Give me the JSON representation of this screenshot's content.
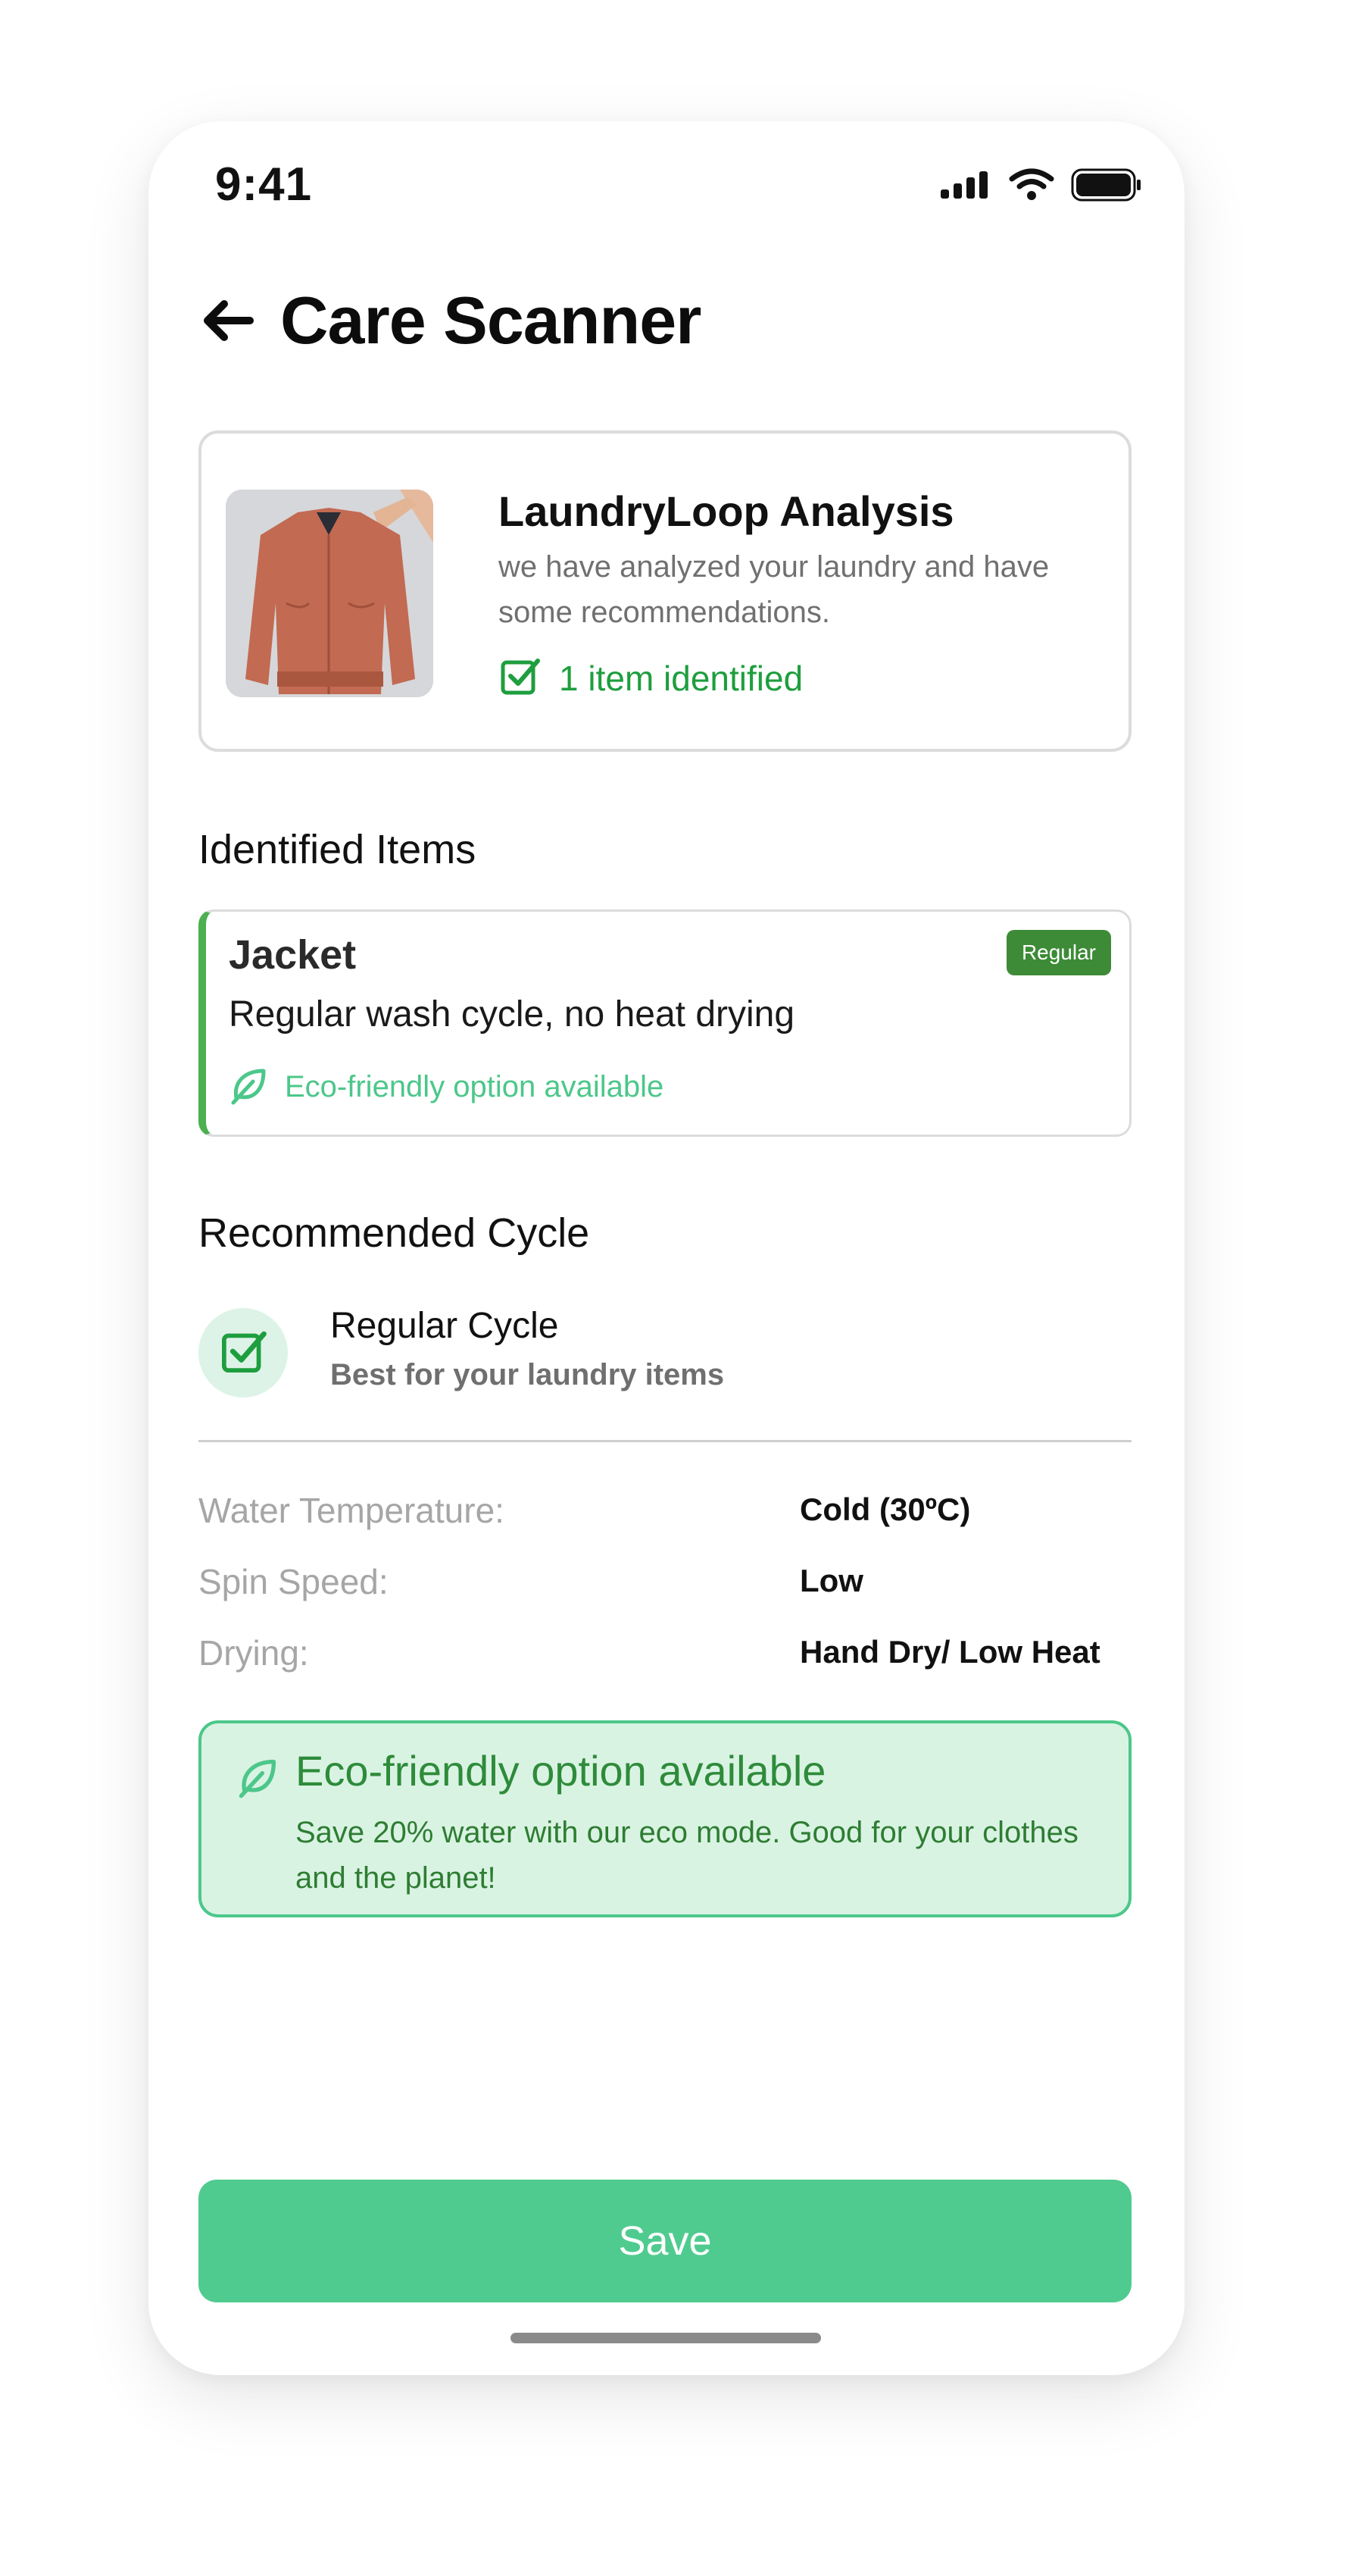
{
  "status_bar": {
    "time": "9:41",
    "icons": [
      "signal-icon",
      "wifi-icon",
      "battery-icon"
    ]
  },
  "header": {
    "back_icon": "arrow-left-icon",
    "title": "Care Scanner"
  },
  "analysis": {
    "image": "jacket-photo",
    "title": "LaundryLoop Analysis",
    "description": "we have analyzed your laundry and have some recommendations.",
    "identified_icon": "check-square-icon",
    "identified_text": "1 item identified"
  },
  "identified_items": {
    "heading": "Identified Items",
    "items": [
      {
        "name": "Jacket",
        "badge": "Regular",
        "description": "Regular wash cycle, no heat drying",
        "eco_icon": "leaf-icon",
        "eco_text": "Eco-friendly option available"
      }
    ]
  },
  "recommended_cycle": {
    "heading": "Recommended Cycle",
    "icon": "check-square-icon",
    "name": "Regular Cycle",
    "subtitle": "Best for your laundry items",
    "specs": [
      {
        "label": "Water Temperature:",
        "value": "Cold (30ºC)"
      },
      {
        "label": "Spin Speed:",
        "value": "Low"
      },
      {
        "label": "Drying:",
        "value": "Hand Dry/ Low Heat"
      }
    ]
  },
  "eco_box": {
    "icon": "leaf-icon",
    "title": "Eco-friendly option available",
    "text": "Save 20% water with our eco mode. Good for your clothes and the planet!"
  },
  "save_button": {
    "label": "Save"
  },
  "colors": {
    "accent_green": "#50cb8f",
    "success_green": "#1e9e3e",
    "badge_green": "#3d8b37",
    "eco_bg": "#d9f3e3"
  }
}
